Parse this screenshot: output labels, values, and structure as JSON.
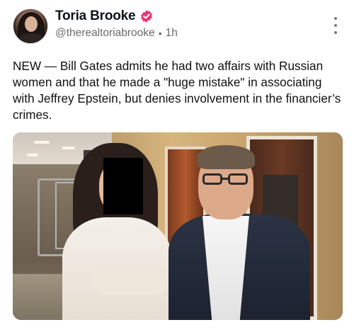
{
  "post": {
    "author": {
      "display_name": "Toria Brooke",
      "handle": "@therealtoriabrooke",
      "time": "1h",
      "verified": true,
      "verified_color": "#e8377a"
    },
    "text": "NEW — Bill Gates admits he had two affairs with Russian women and that he made a \"huge mistake\" in associating with Jeffrey Epstein, but denies involvement in the financier’s crimes.",
    "separator": "•",
    "icons": {
      "more": "more-vertical-icon",
      "verified": "verified-badge-icon"
    }
  }
}
